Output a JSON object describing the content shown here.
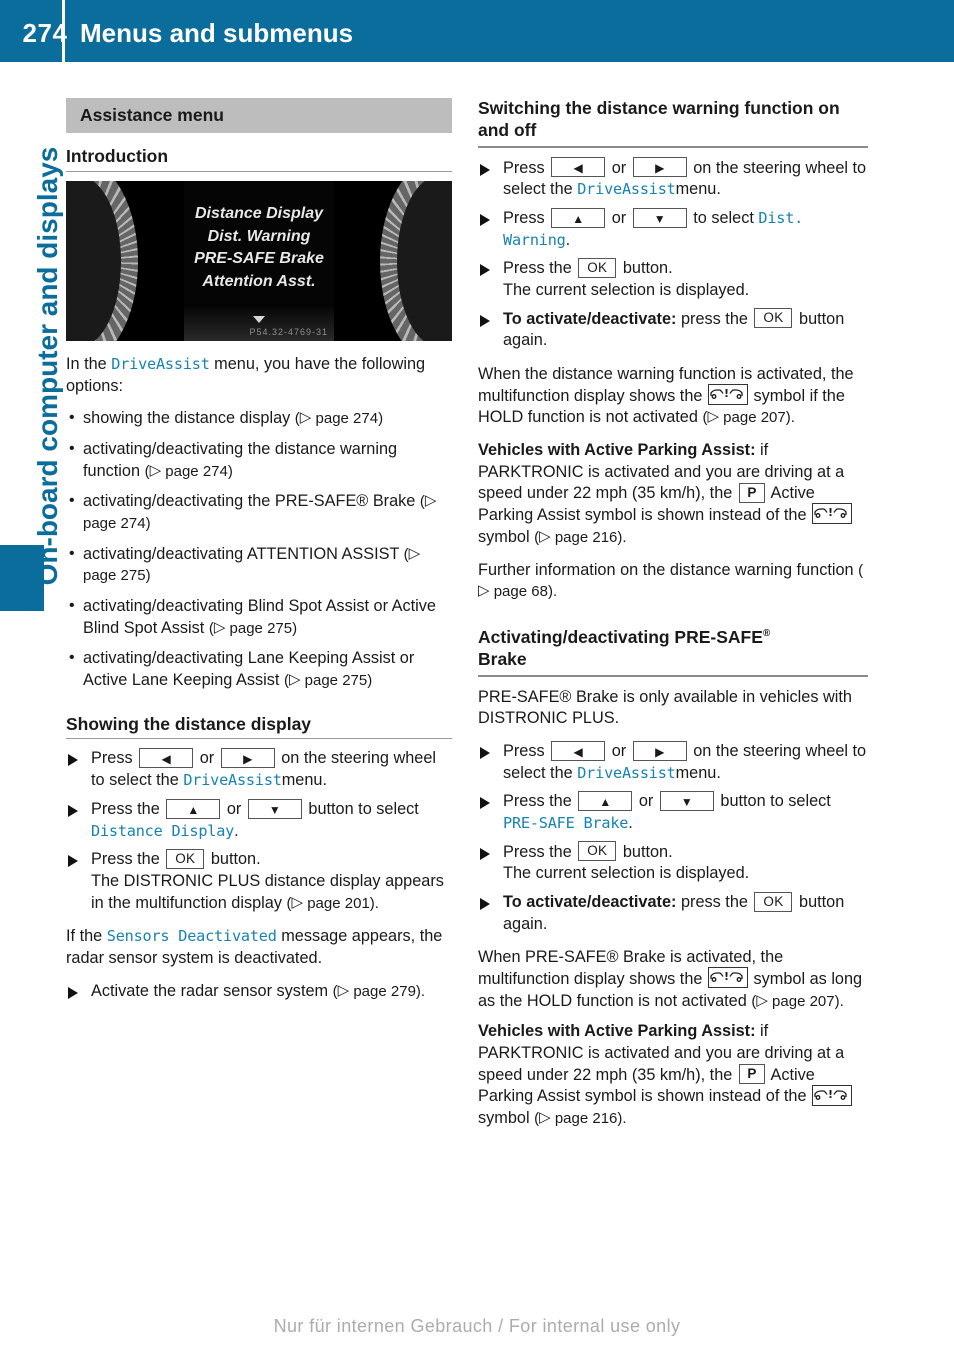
{
  "header": {
    "page_number": "274",
    "title": "Menus and submenus"
  },
  "sidebar": {
    "chapter_label": "On-board computer and displays"
  },
  "colors": {
    "brand_blue": "#0a6d9c",
    "ui_string_blue": "#1683b0",
    "section_bar_gray": "#bdbdbd"
  },
  "left_column": {
    "section_bar": "Assistance menu",
    "intro_heading": "Introduction",
    "cluster_image": {
      "menu_items": [
        "Distance Display",
        "Dist. Warning",
        "PRE-SAFE Brake",
        "Attention Asst."
      ],
      "image_code": "P54.32-4769-31"
    },
    "intro_lead_1": "In the ",
    "intro_lead_ui": "DriveAssist",
    "intro_lead_2": " menu, you have the following options:",
    "options": [
      {
        "text": "showing the distance display",
        "ref": "page 274"
      },
      {
        "text": "activating/deactivating the distance warning function",
        "ref": "page 274"
      },
      {
        "text": "activating/deactivating the PRE-SAFE® Brake",
        "ref": "page 274"
      },
      {
        "text": "activating/deactivating ATTENTION ASSIST",
        "ref": "page 275"
      },
      {
        "text": "activating/deactivating Blind Spot Assist or Active Blind Spot Assist",
        "ref": "page 275"
      },
      {
        "text": "activating/deactivating Lane Keeping Assist or Active Lane Keeping Assist",
        "ref": "page 275"
      }
    ],
    "showing_heading": "Showing the distance display",
    "step1_a": "Press",
    "step1_b": "or",
    "step1_c": "on the steering wheel to select the",
    "step1_ui": "DriveAssist",
    "step1_d": "menu.",
    "step2_a": "Press the",
    "step2_b": "or",
    "step2_c": "button to select",
    "step2_ui": "Distance Display",
    "step2_d": ".",
    "step3_a": "Press the",
    "step3_key": "OK",
    "step3_b": "button.",
    "step3_result": "The DISTRONIC PLUS distance display appears in the multifunction display",
    "step3_ref": "page 201",
    "sensors_a": "If the",
    "sensors_ui": "Sensors Deactivated",
    "sensors_b": "message appears, the radar sensor system is deactivated.",
    "step4": "Activate the radar sensor system",
    "step4_ref": "page 279"
  },
  "right_column": {
    "switching_heading": "Switching the distance warning function on and off",
    "sw_step1_a": "Press",
    "sw_step1_b": "or",
    "sw_step1_c": "on the steering wheel to select the",
    "sw_step1_ui": "DriveAssist",
    "sw_step1_d": "menu.",
    "sw_step2_a": "Press",
    "sw_step2_b": "or",
    "sw_step2_c": "to select",
    "sw_step2_ui": "Dist. Warning",
    "sw_step2_d": ".",
    "sw_step3_a": "Press the",
    "sw_step3_key": "OK",
    "sw_step3_b": "button.",
    "sw_step3_result": "The current selection is displayed.",
    "sw_step4_bold": "To activate/deactivate:",
    "sw_step4_a": "press the",
    "sw_step4_key": "OK",
    "sw_step4_b": "button again.",
    "dw_para_a": "When the distance warning function is activated, the multifunction display shows the",
    "dw_para_b": "symbol if the HOLD function is not activated",
    "dw_para_ref": "page 207",
    "apa_bold_1": "Vehicles with Active Parking Assist:",
    "apa_text_1a": "if PARKTRONIC is activated and you are driving at a speed under 22 mph (35 km/h), the",
    "apa_key_1": "P",
    "apa_text_1b": "Active Parking Assist symbol is shown instead of the",
    "apa_text_1c": "symbol",
    "apa_ref_1": "page 216",
    "further_info": "Further information on the distance warning function",
    "further_ref": "page 68",
    "presafe_heading_1": "Activating/deactivating PRE-SAFE",
    "presafe_heading_2": "Brake",
    "presafe_avail": "PRE-SAFE® Brake is only available in vehicles with DISTRONIC PLUS.",
    "ps_step1_a": "Press",
    "ps_step1_b": "or",
    "ps_step1_c": "on the steering wheel to select the",
    "ps_step1_ui": "DriveAssist",
    "ps_step1_d": "menu.",
    "ps_step2_a": "Press the",
    "ps_step2_b": "or",
    "ps_step2_c": "button to select",
    "ps_step2_ui": "PRE-SAFE Brake",
    "ps_step2_d": ".",
    "ps_step3_a": "Press the",
    "ps_step3_key": "OK",
    "ps_step3_b": "button.",
    "ps_step3_result": "The current selection is displayed.",
    "ps_step4_bold": "To activate/deactivate:",
    "ps_step4_a": "press the",
    "ps_step4_key": "OK",
    "ps_step4_b": "button again.",
    "ps_para_a": "When PRE-SAFE® Brake is activated, the multifunction display shows the",
    "ps_para_b": "symbol as long as the HOLD function is not activated",
    "ps_para_ref": "page 207",
    "apa_bold_2": "Vehicles with Active Parking Assist:",
    "apa_text_2a": "if PARKTRONIC is activated and you are driving at a speed under 22 mph (35 km/h), the",
    "apa_key_2": "P",
    "apa_text_2b": "Active Parking Assist symbol is shown instead of the",
    "apa_text_2c": "symbol",
    "apa_ref_2": "page 216"
  },
  "footer": {
    "watermark": "Nur für internen Gebrauch / For internal use only"
  }
}
